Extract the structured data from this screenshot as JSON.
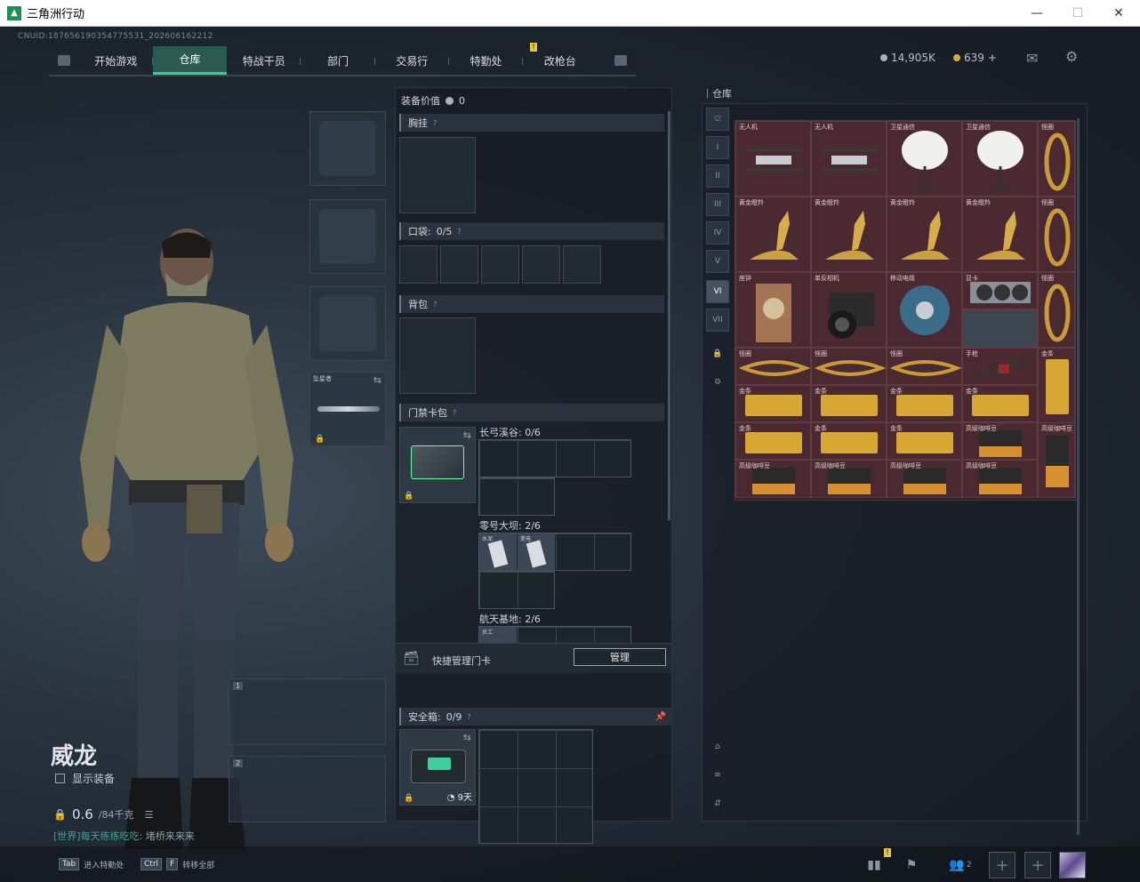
{
  "window": {
    "title": "三角洲行动"
  },
  "header": {
    "uid": "CNUID:187656190354775531_202606162212",
    "tabs": [
      {
        "label": "开始游戏"
      },
      {
        "label": "仓库"
      },
      {
        "label": "特战干员"
      },
      {
        "label": "部门"
      },
      {
        "label": "交易行"
      },
      {
        "label": "特勤处"
      },
      {
        "label": "改枪台"
      }
    ],
    "currency_main": "14,905K",
    "currency_premium": "639",
    "plus": "+",
    "notice_badge": "!"
  },
  "character": {
    "name": "威龙",
    "show_equipment": "显示装备",
    "weight_value": "0.6",
    "weight_max": "/84千克",
    "chat_channel": "[世界]",
    "chat_user": "每天练练吃吃",
    "chat_msg": "堵桥来来来",
    "melee_label": "坠星者",
    "weapon_slots": [
      "1",
      "2"
    ]
  },
  "loadout": {
    "equip_value_label": "装备价值",
    "equip_value": "0",
    "chest_rig": "胸挂",
    "pockets": "口袋:",
    "pockets_count": "0/5",
    "backpack": "背包",
    "keycard_case": "门禁卡包",
    "key_groups": [
      {
        "label": "长弓溪谷: 0/6"
      },
      {
        "label": "零号大坝: 2/6"
      },
      {
        "label": "航天基地: 2/6"
      }
    ],
    "key_item_labels": [
      "水泥",
      "变电",
      "员工"
    ],
    "quick_manage": "快捷管理门卡",
    "manage_btn": "管理",
    "safe_box": "安全箱:",
    "safe_box_count": "0/9",
    "safe_box_timer": "9天",
    "help": "?"
  },
  "stash": {
    "title": "仓库",
    "items": [
      {
        "name": "无人机"
      },
      {
        "name": "无人机"
      },
      {
        "name": "卫星通信"
      },
      {
        "name": "卫星通信"
      },
      {
        "name": "怪圈"
      },
      {
        "name": "黄金瞪羚"
      },
      {
        "name": "黄金瞪羚"
      },
      {
        "name": "黄金瞪羚"
      },
      {
        "name": "黄金瞪羚"
      },
      {
        "name": "怪圈"
      },
      {
        "name": "座钟"
      },
      {
        "name": "单反相机"
      },
      {
        "name": "移动电缆"
      },
      {
        "name": "显卡"
      },
      {
        "name": "怪圈"
      },
      {
        "name": "怪圈"
      },
      {
        "name": "怪圈"
      },
      {
        "name": "怪圈"
      },
      {
        "name": "手枪"
      },
      {
        "name": "金条"
      },
      {
        "name": "金条"
      },
      {
        "name": "金条"
      },
      {
        "name": "金条"
      },
      {
        "name": "金条"
      },
      {
        "name": "金条"
      },
      {
        "name": "金条"
      },
      {
        "name": "金条"
      },
      {
        "name": "高级咖啡豆"
      },
      {
        "name": "高级咖啡豆"
      },
      {
        "name": "高级咖啡豆"
      },
      {
        "name": "高级咖啡豆"
      },
      {
        "name": "高级咖啡豆"
      },
      {
        "name": "高级咖啡豆"
      }
    ]
  },
  "bottom": {
    "tab_key": "Tab",
    "tab_action": "进入特勤处",
    "ctrl_key": "Ctrl",
    "f_key": "F",
    "transfer_action": "转移全部",
    "squad_count": "2"
  }
}
